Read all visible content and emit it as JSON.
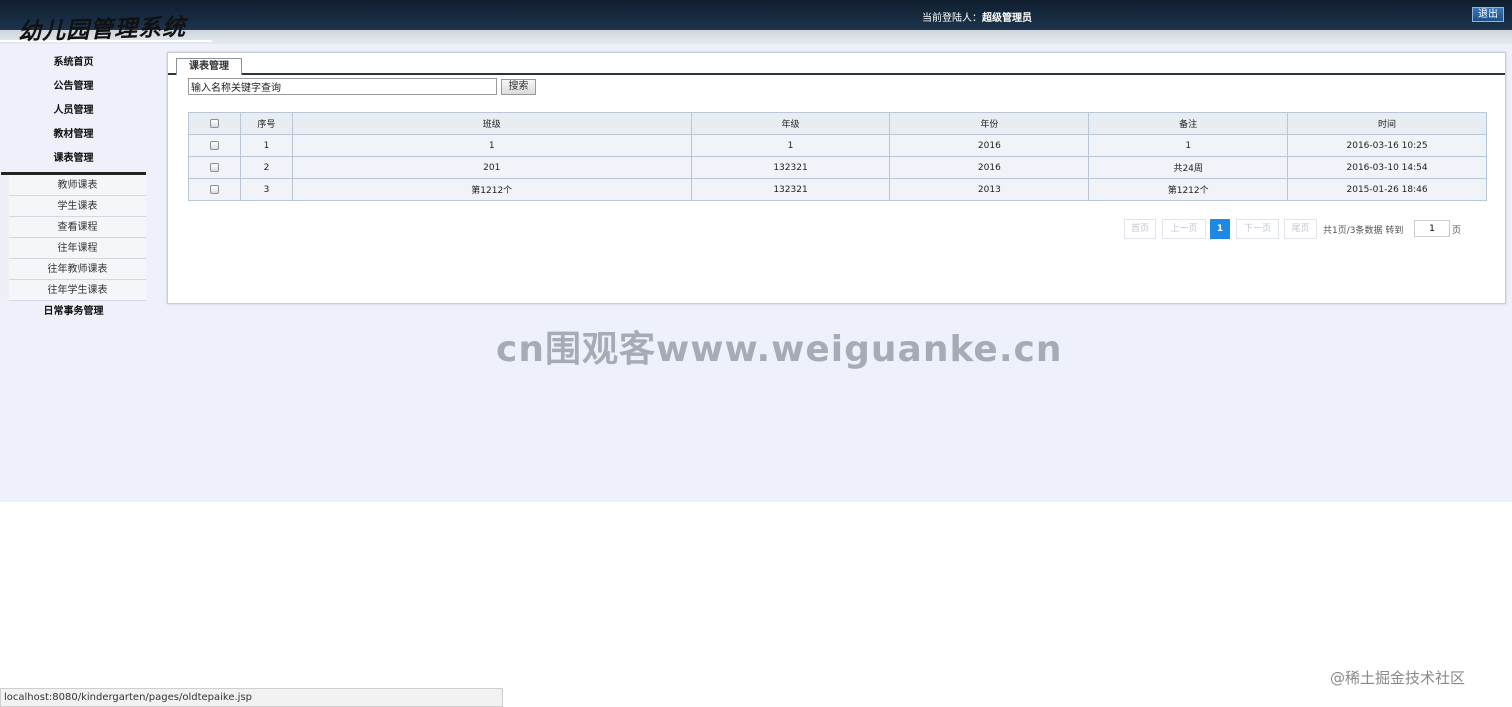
{
  "header": {
    "logo_text": "幼儿园管理系统",
    "welcome_label": "当前登陆人：",
    "username": "超级管理员",
    "logout_label": "退出"
  },
  "sidebar": {
    "items": [
      {
        "label": "系统首页"
      },
      {
        "label": "公告管理"
      },
      {
        "label": "人员管理"
      },
      {
        "label": "教材管理"
      },
      {
        "label": "课表管理"
      }
    ],
    "submenu": [
      {
        "label": "教师课表"
      },
      {
        "label": "学生课表"
      },
      {
        "label": "查看课程"
      },
      {
        "label": "往年课程"
      },
      {
        "label": "往年教师课表"
      },
      {
        "label": "往年学生课表"
      }
    ],
    "after_items": [
      {
        "label": "日常事务管理"
      }
    ]
  },
  "panel": {
    "tab_label": "课表管理",
    "search_placeholder": "输入名称关键字查询",
    "search_button": "搜索"
  },
  "table": {
    "columns": [
      "序号",
      "班级",
      "年级",
      "年份",
      "备注",
      "时间"
    ],
    "rows": [
      [
        "1",
        "1",
        "1",
        "2016",
        "1",
        "2016-03-16 10:25"
      ],
      [
        "2",
        "201",
        "132321",
        "2016",
        "共24周",
        "2016-03-10 14:54"
      ],
      [
        "3",
        "第1212个",
        "132321",
        "2013",
        "第1212个",
        "2015-01-26 18:46"
      ]
    ]
  },
  "pager": {
    "first": "首页",
    "prev": "上一页",
    "current": "1",
    "next": "下一页",
    "last": "尾页",
    "info": "共1页/3条数据",
    "goto_label": "转到",
    "goto_value": "1",
    "page_suffix": "页"
  },
  "watermark": "cn围观客www.weiguanke.cn",
  "credit": "@稀土掘金技术社区",
  "status_url": "localhost:8080/kindergarten/pages/oldtepaike.jsp"
}
